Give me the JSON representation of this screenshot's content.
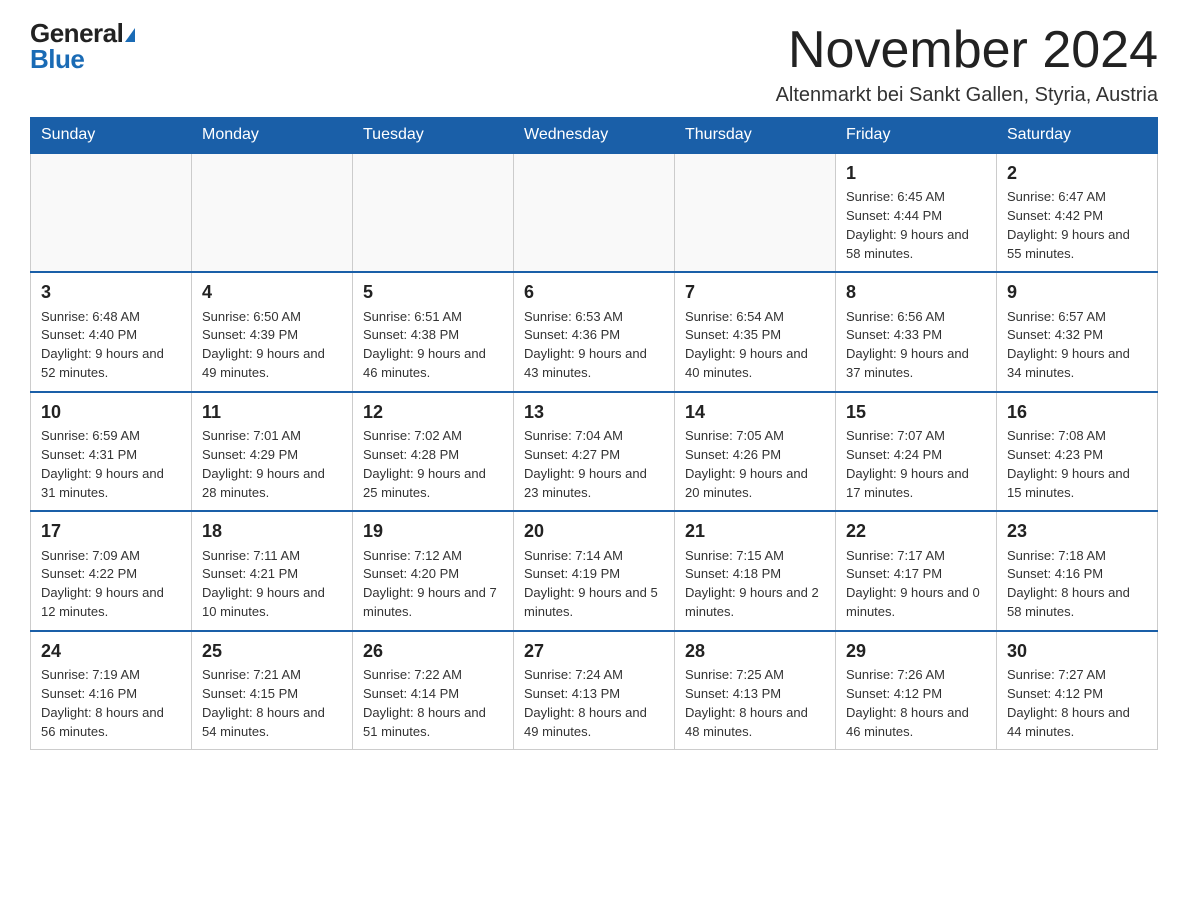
{
  "logo": {
    "general": "General",
    "blue": "Blue"
  },
  "title": "November 2024",
  "location": "Altenmarkt bei Sankt Gallen, Styria, Austria",
  "headers": [
    "Sunday",
    "Monday",
    "Tuesday",
    "Wednesday",
    "Thursday",
    "Friday",
    "Saturday"
  ],
  "weeks": [
    [
      {
        "day": "",
        "info": ""
      },
      {
        "day": "",
        "info": ""
      },
      {
        "day": "",
        "info": ""
      },
      {
        "day": "",
        "info": ""
      },
      {
        "day": "",
        "info": ""
      },
      {
        "day": "1",
        "info": "Sunrise: 6:45 AM\nSunset: 4:44 PM\nDaylight: 9 hours and 58 minutes."
      },
      {
        "day": "2",
        "info": "Sunrise: 6:47 AM\nSunset: 4:42 PM\nDaylight: 9 hours and 55 minutes."
      }
    ],
    [
      {
        "day": "3",
        "info": "Sunrise: 6:48 AM\nSunset: 4:40 PM\nDaylight: 9 hours and 52 minutes."
      },
      {
        "day": "4",
        "info": "Sunrise: 6:50 AM\nSunset: 4:39 PM\nDaylight: 9 hours and 49 minutes."
      },
      {
        "day": "5",
        "info": "Sunrise: 6:51 AM\nSunset: 4:38 PM\nDaylight: 9 hours and 46 minutes."
      },
      {
        "day": "6",
        "info": "Sunrise: 6:53 AM\nSunset: 4:36 PM\nDaylight: 9 hours and 43 minutes."
      },
      {
        "day": "7",
        "info": "Sunrise: 6:54 AM\nSunset: 4:35 PM\nDaylight: 9 hours and 40 minutes."
      },
      {
        "day": "8",
        "info": "Sunrise: 6:56 AM\nSunset: 4:33 PM\nDaylight: 9 hours and 37 minutes."
      },
      {
        "day": "9",
        "info": "Sunrise: 6:57 AM\nSunset: 4:32 PM\nDaylight: 9 hours and 34 minutes."
      }
    ],
    [
      {
        "day": "10",
        "info": "Sunrise: 6:59 AM\nSunset: 4:31 PM\nDaylight: 9 hours and 31 minutes."
      },
      {
        "day": "11",
        "info": "Sunrise: 7:01 AM\nSunset: 4:29 PM\nDaylight: 9 hours and 28 minutes."
      },
      {
        "day": "12",
        "info": "Sunrise: 7:02 AM\nSunset: 4:28 PM\nDaylight: 9 hours and 25 minutes."
      },
      {
        "day": "13",
        "info": "Sunrise: 7:04 AM\nSunset: 4:27 PM\nDaylight: 9 hours and 23 minutes."
      },
      {
        "day": "14",
        "info": "Sunrise: 7:05 AM\nSunset: 4:26 PM\nDaylight: 9 hours and 20 minutes."
      },
      {
        "day": "15",
        "info": "Sunrise: 7:07 AM\nSunset: 4:24 PM\nDaylight: 9 hours and 17 minutes."
      },
      {
        "day": "16",
        "info": "Sunrise: 7:08 AM\nSunset: 4:23 PM\nDaylight: 9 hours and 15 minutes."
      }
    ],
    [
      {
        "day": "17",
        "info": "Sunrise: 7:09 AM\nSunset: 4:22 PM\nDaylight: 9 hours and 12 minutes."
      },
      {
        "day": "18",
        "info": "Sunrise: 7:11 AM\nSunset: 4:21 PM\nDaylight: 9 hours and 10 minutes."
      },
      {
        "day": "19",
        "info": "Sunrise: 7:12 AM\nSunset: 4:20 PM\nDaylight: 9 hours and 7 minutes."
      },
      {
        "day": "20",
        "info": "Sunrise: 7:14 AM\nSunset: 4:19 PM\nDaylight: 9 hours and 5 minutes."
      },
      {
        "day": "21",
        "info": "Sunrise: 7:15 AM\nSunset: 4:18 PM\nDaylight: 9 hours and 2 minutes."
      },
      {
        "day": "22",
        "info": "Sunrise: 7:17 AM\nSunset: 4:17 PM\nDaylight: 9 hours and 0 minutes."
      },
      {
        "day": "23",
        "info": "Sunrise: 7:18 AM\nSunset: 4:16 PM\nDaylight: 8 hours and 58 minutes."
      }
    ],
    [
      {
        "day": "24",
        "info": "Sunrise: 7:19 AM\nSunset: 4:16 PM\nDaylight: 8 hours and 56 minutes."
      },
      {
        "day": "25",
        "info": "Sunrise: 7:21 AM\nSunset: 4:15 PM\nDaylight: 8 hours and 54 minutes."
      },
      {
        "day": "26",
        "info": "Sunrise: 7:22 AM\nSunset: 4:14 PM\nDaylight: 8 hours and 51 minutes."
      },
      {
        "day": "27",
        "info": "Sunrise: 7:24 AM\nSunset: 4:13 PM\nDaylight: 8 hours and 49 minutes."
      },
      {
        "day": "28",
        "info": "Sunrise: 7:25 AM\nSunset: 4:13 PM\nDaylight: 8 hours and 48 minutes."
      },
      {
        "day": "29",
        "info": "Sunrise: 7:26 AM\nSunset: 4:12 PM\nDaylight: 8 hours and 46 minutes."
      },
      {
        "day": "30",
        "info": "Sunrise: 7:27 AM\nSunset: 4:12 PM\nDaylight: 8 hours and 44 minutes."
      }
    ]
  ]
}
